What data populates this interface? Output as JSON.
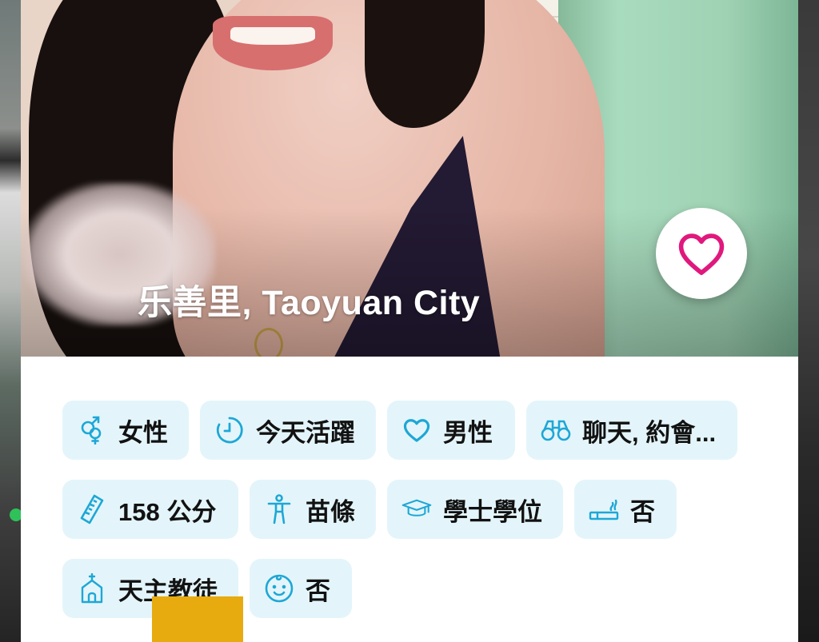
{
  "profile": {
    "location": "乐善里, Taoyuan City"
  },
  "actions": {
    "like_icon": "heart-outline-icon"
  },
  "tags": [
    {
      "icon": "gender-icon",
      "label": "女性"
    },
    {
      "icon": "clock-icon",
      "label": "今天活躍"
    },
    {
      "icon": "heart-icon",
      "label": "男性"
    },
    {
      "icon": "binoculars-icon",
      "label": "聊天, 約會..."
    },
    {
      "icon": "ruler-icon",
      "label": "158 公分"
    },
    {
      "icon": "body-icon",
      "label": "苗條"
    },
    {
      "icon": "graduation-cap-icon",
      "label": "學士學位"
    },
    {
      "icon": "cigarette-icon",
      "label": "否"
    },
    {
      "icon": "church-icon",
      "label": "天主教徒"
    },
    {
      "icon": "baby-icon",
      "label": "否"
    }
  ],
  "colors": {
    "accent": "#e0187e",
    "chip_bg": "#e3f5fa",
    "icon": "#1ea7d6",
    "online": "#2fc15a"
  }
}
